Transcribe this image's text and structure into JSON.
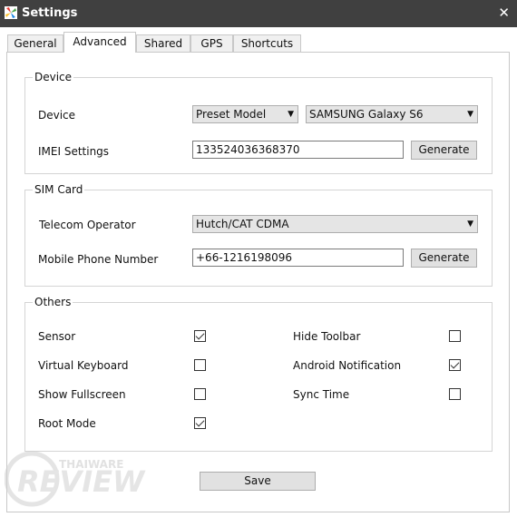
{
  "window": {
    "title": "Settings",
    "close_symbol": "✕"
  },
  "tabs": [
    {
      "label": "General"
    },
    {
      "label": "Advanced",
      "active": true
    },
    {
      "label": "Shared"
    },
    {
      "label": "GPS"
    },
    {
      "label": "Shortcuts"
    }
  ],
  "device": {
    "group_title": "Device",
    "device_label": "Device",
    "preset_select": "Preset Model",
    "model_select": "SAMSUNG Galaxy S6",
    "imei_label": "IMEI Settings",
    "imei_value": "133524036368370",
    "generate_label": "Generate"
  },
  "sim": {
    "group_title": "SIM Card",
    "operator_label": "Telecom Operator",
    "operator_select": "Hutch/CAT CDMA",
    "phone_label": "Mobile Phone Number",
    "phone_value": "+66-1216198096",
    "generate_label": "Generate"
  },
  "others": {
    "group_title": "Others",
    "sensor": {
      "label": "Sensor",
      "checked": true
    },
    "virtual_keyboard": {
      "label": "Virtual Keyboard",
      "checked": false
    },
    "show_fullscreen": {
      "label": "Show Fullscreen",
      "checked": false
    },
    "root_mode": {
      "label": "Root Mode",
      "checked": true
    },
    "hide_toolbar": {
      "label": "Hide Toolbar",
      "checked": false
    },
    "android_notification": {
      "label": "Android Notification",
      "checked": true
    },
    "sync_time": {
      "label": "Sync Time",
      "checked": false
    }
  },
  "save_label": "Save",
  "watermark": {
    "top": "THAIWARE",
    "bottom": "REVIEW"
  }
}
